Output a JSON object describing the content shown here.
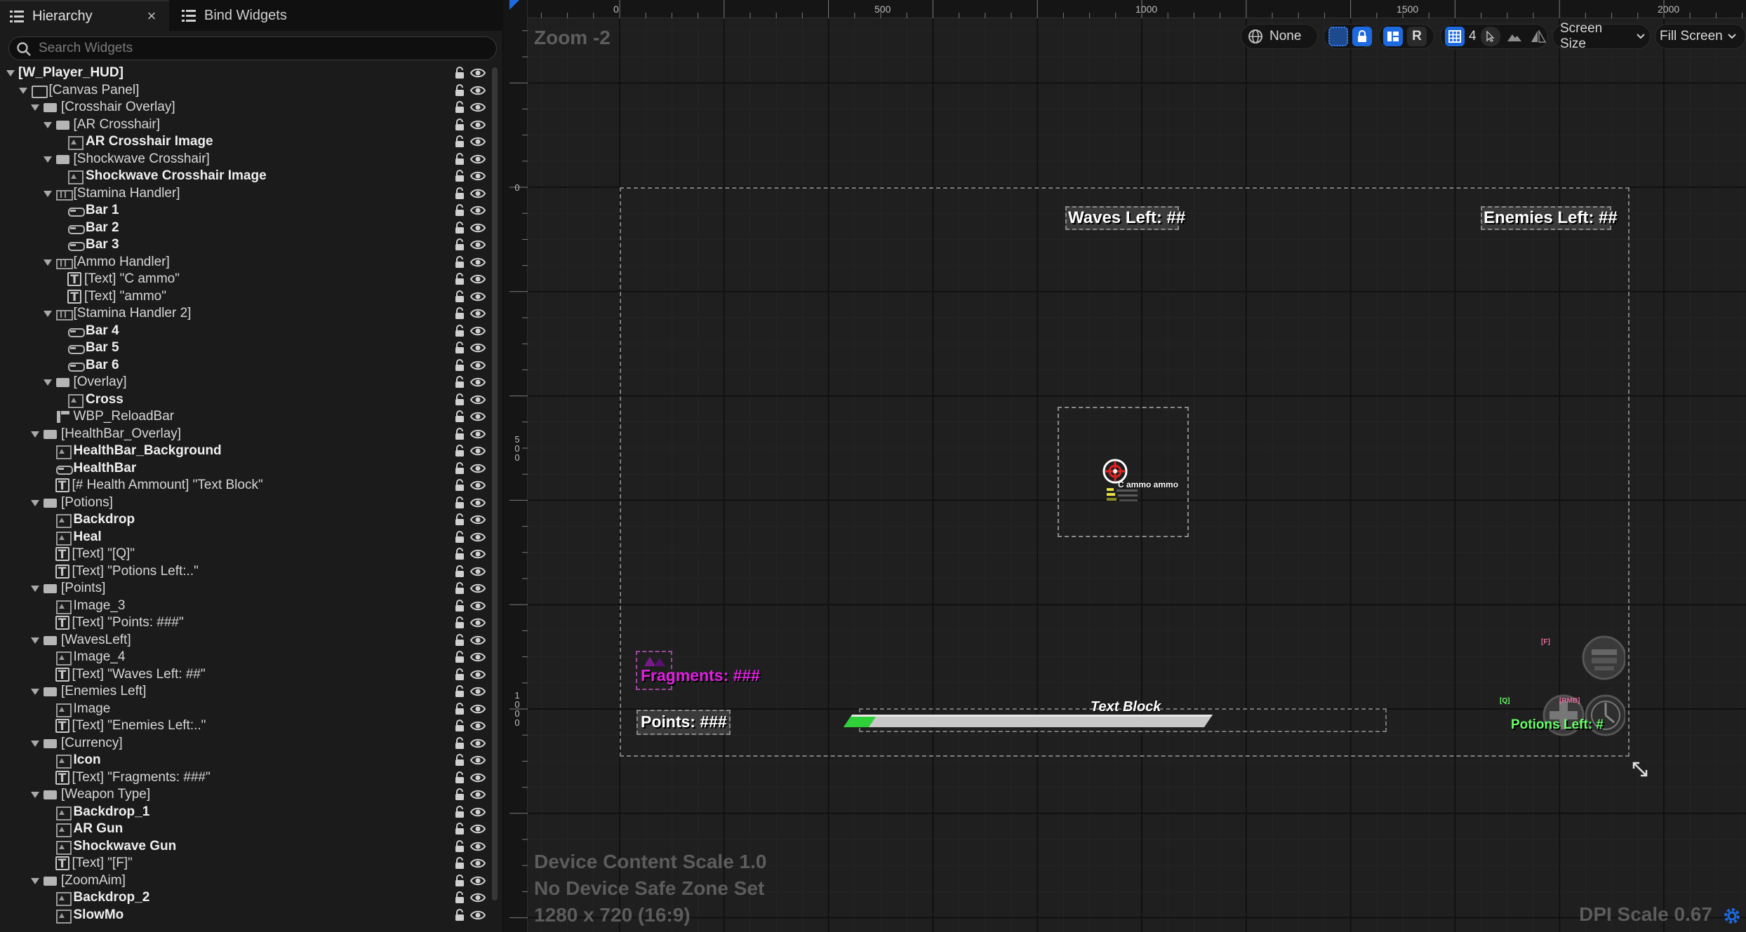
{
  "tabs": {
    "hierarchy": "Hierarchy",
    "close": "×",
    "bind_widgets": "Bind Widgets"
  },
  "search": {
    "placeholder": "Search Widgets"
  },
  "tree": [
    {
      "label": "[W_Player_HUD]",
      "indent": 0,
      "icon": "none",
      "open": true,
      "bold": true,
      "root": true
    },
    {
      "label": "[Canvas Panel]",
      "indent": 1,
      "icon": "panel",
      "open": true,
      "bold": false
    },
    {
      "label": "[Crosshair Overlay]",
      "indent": 2,
      "icon": "overlay",
      "open": true,
      "bold": false
    },
    {
      "label": "[AR Crosshair]",
      "indent": 3,
      "icon": "overlay",
      "open": true,
      "bold": false
    },
    {
      "label": "AR Crosshair Image",
      "indent": 4,
      "icon": "image",
      "open": false,
      "bold": true
    },
    {
      "label": "[Shockwave Crosshair]",
      "indent": 3,
      "icon": "overlay",
      "open": true,
      "bold": false
    },
    {
      "label": "Shockwave Crosshair Image",
      "indent": 4,
      "icon": "image",
      "open": false,
      "bold": true
    },
    {
      "label": "[Stamina Handler]",
      "indent": 3,
      "icon": "hbox",
      "open": true,
      "bold": false
    },
    {
      "label": "Bar 1",
      "indent": 4,
      "icon": "bar",
      "open": false,
      "bold": true
    },
    {
      "label": "Bar 2",
      "indent": 4,
      "icon": "bar",
      "open": false,
      "bold": true
    },
    {
      "label": "Bar 3",
      "indent": 4,
      "icon": "bar",
      "open": false,
      "bold": true
    },
    {
      "label": "[Ammo Handler]",
      "indent": 3,
      "icon": "hbox",
      "open": true,
      "bold": false
    },
    {
      "label": "[Text] \"C ammo\"",
      "indent": 4,
      "icon": "text",
      "open": false,
      "bold": false
    },
    {
      "label": "[Text] \"ammo\"",
      "indent": 4,
      "icon": "text",
      "open": false,
      "bold": false
    },
    {
      "label": "[Stamina Handler 2]",
      "indent": 3,
      "icon": "hbox",
      "open": true,
      "bold": false
    },
    {
      "label": "Bar 4",
      "indent": 4,
      "icon": "bar",
      "open": false,
      "bold": true
    },
    {
      "label": "Bar 5",
      "indent": 4,
      "icon": "bar",
      "open": false,
      "bold": true
    },
    {
      "label": "Bar 6",
      "indent": 4,
      "icon": "bar",
      "open": false,
      "bold": true
    },
    {
      "label": "[Overlay]",
      "indent": 3,
      "icon": "overlay",
      "open": true,
      "bold": false
    },
    {
      "label": "Cross",
      "indent": 4,
      "icon": "image",
      "open": false,
      "bold": true
    },
    {
      "label": "WBP_ReloadBar",
      "indent": 3,
      "icon": "userw",
      "open": false,
      "bold": false
    },
    {
      "label": "[HealthBar_Overlay]",
      "indent": 2,
      "icon": "overlay",
      "open": true,
      "bold": false
    },
    {
      "label": "HealthBar_Background",
      "indent": 3,
      "icon": "image",
      "open": false,
      "bold": true
    },
    {
      "label": "HealthBar",
      "indent": 3,
      "icon": "bar",
      "open": false,
      "bold": true
    },
    {
      "label": "[# Health Ammount] \"Text Block\"",
      "indent": 3,
      "icon": "text",
      "open": false,
      "bold": false
    },
    {
      "label": "[Potions]",
      "indent": 2,
      "icon": "overlay",
      "open": true,
      "bold": false
    },
    {
      "label": "Backdrop",
      "indent": 3,
      "icon": "image",
      "open": false,
      "bold": true
    },
    {
      "label": "Heal",
      "indent": 3,
      "icon": "image",
      "open": false,
      "bold": true
    },
    {
      "label": "[Text] \"[Q]\"",
      "indent": 3,
      "icon": "text",
      "open": false,
      "bold": false
    },
    {
      "label": "[Text] \"Potions Left:..\"",
      "indent": 3,
      "icon": "text",
      "open": false,
      "bold": false
    },
    {
      "label": "[Points]",
      "indent": 2,
      "icon": "overlay",
      "open": true,
      "bold": false
    },
    {
      "label": "Image_3",
      "indent": 3,
      "icon": "image",
      "open": false,
      "bold": false
    },
    {
      "label": "[Text] \"Points: ###\"",
      "indent": 3,
      "icon": "text",
      "open": false,
      "bold": false
    },
    {
      "label": "[WavesLeft]",
      "indent": 2,
      "icon": "overlay",
      "open": true,
      "bold": false
    },
    {
      "label": "Image_4",
      "indent": 3,
      "icon": "image",
      "open": false,
      "bold": false
    },
    {
      "label": "[Text] \"Waves Left: ##\"",
      "indent": 3,
      "icon": "text",
      "open": false,
      "bold": false
    },
    {
      "label": "[Enemies Left]",
      "indent": 2,
      "icon": "overlay",
      "open": true,
      "bold": false
    },
    {
      "label": "Image",
      "indent": 3,
      "icon": "image",
      "open": false,
      "bold": false
    },
    {
      "label": "[Text] \"Enemies Left:..\"",
      "indent": 3,
      "icon": "text",
      "open": false,
      "bold": false
    },
    {
      "label": "[Currency]",
      "indent": 2,
      "icon": "overlay",
      "open": true,
      "bold": false
    },
    {
      "label": "Icon",
      "indent": 3,
      "icon": "image",
      "open": false,
      "bold": true
    },
    {
      "label": "[Text] \"Fragments: ###\"",
      "indent": 3,
      "icon": "text",
      "open": false,
      "bold": false
    },
    {
      "label": "[Weapon Type]",
      "indent": 2,
      "icon": "overlay",
      "open": true,
      "bold": false
    },
    {
      "label": "Backdrop_1",
      "indent": 3,
      "icon": "image",
      "open": false,
      "bold": true
    },
    {
      "label": "AR Gun",
      "indent": 3,
      "icon": "image",
      "open": false,
      "bold": true
    },
    {
      "label": "Shockwave Gun",
      "indent": 3,
      "icon": "image",
      "open": false,
      "bold": true
    },
    {
      "label": "[Text] \"[F]\"",
      "indent": 3,
      "icon": "text",
      "open": false,
      "bold": false
    },
    {
      "label": "[ZoomAim]",
      "indent": 2,
      "icon": "overlay",
      "open": true,
      "bold": false
    },
    {
      "label": "Backdrop_2",
      "indent": 3,
      "icon": "image",
      "open": false,
      "bold": true
    },
    {
      "label": "SlowMo",
      "indent": 3,
      "icon": "image",
      "open": false,
      "bold": true
    }
  ],
  "designer": {
    "zoom": "Zoom -2",
    "ruler_top": [
      "0",
      "500",
      "1000",
      "1500",
      "2000"
    ],
    "ruler_left": [
      "0",
      "500",
      "1000"
    ],
    "toolbar": {
      "translucency": "None",
      "layout_mode": "R",
      "grid_snap": "4",
      "screen_size": "Screen Size",
      "fill_mode": "Fill Screen"
    },
    "info": {
      "content_scale": "Device Content Scale 1.0",
      "safe_zone": "No Device Safe Zone Set",
      "resolution": "1280 x 720 (16:9)",
      "dpi": "DPI Scale 0.67"
    },
    "hud": {
      "waves_left": "Waves Left: ##",
      "enemies_left": "Enemies Left: ##",
      "fragments": "Fragments: ###",
      "points": "Points: ###",
      "text_block": "Text Block",
      "potions_left": "Potions Left: #",
      "ammo_text": "C ammo ammo",
      "key_q": "[Q]",
      "key_f": "[F]",
      "key_rmb": "[RMB]",
      "health_fraction": 0.07
    },
    "colors": {
      "accent": "#1d6ae0",
      "fragments": "#e020e0",
      "health": "#2fd03a",
      "potions": "#66ff66"
    }
  }
}
